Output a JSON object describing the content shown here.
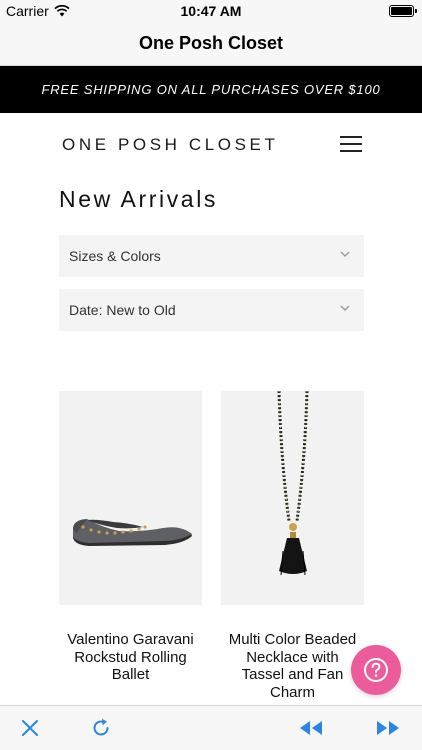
{
  "status_bar": {
    "carrier": "Carrier",
    "time": "10:47 AM"
  },
  "nav": {
    "title": "One Posh Closet"
  },
  "promo": {
    "text": "FREE SHIPPING ON ALL PURCHASES OVER $100"
  },
  "site": {
    "logo": "ONE POSH CLOSET",
    "menu_icon": "hamburger-menu-icon"
  },
  "page": {
    "heading": "New Arrivals"
  },
  "filters": {
    "sizes_label": "Sizes & Colors",
    "sort_label": "Date: New to Old"
  },
  "products": [
    {
      "name": "Valentino Garavani Rockstud Rolling Ballet",
      "image": "black-studded-ballet-flat"
    },
    {
      "name": "Multi Color Beaded Necklace with Tassel and Fan Charm",
      "image": "beaded-necklace-black-tassel"
    }
  ],
  "colors": {
    "accent": "#ec5c9a",
    "toolbar_icon": "#2b86e6",
    "banner": "#000000"
  },
  "toolbar": {
    "icons": [
      "close-icon",
      "refresh-icon",
      "rewind-icon",
      "fast-forward-icon"
    ]
  }
}
